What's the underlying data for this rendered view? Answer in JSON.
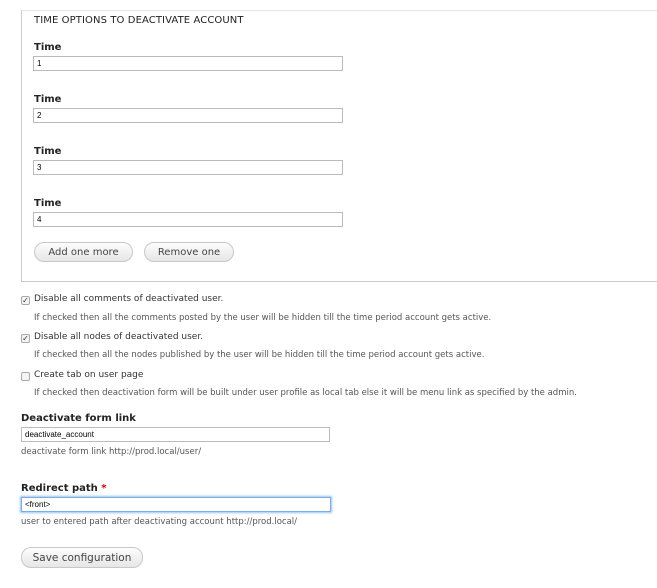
{
  "fieldset": {
    "legend": "TIME OPTIONS TO DEACTIVATE ACCOUNT",
    "times": [
      {
        "label": "Time",
        "value": "1"
      },
      {
        "label": "Time",
        "value": "2"
      },
      {
        "label": "Time",
        "value": "3"
      },
      {
        "label": "Time",
        "value": "4"
      }
    ],
    "add_label": "Add one more",
    "remove_label": "Remove one"
  },
  "options": [
    {
      "label": "Disable all comments of deactivated user.",
      "checked": true,
      "desc": "If checked then all the comments posted by the user will be hidden till the time period account gets active."
    },
    {
      "label": "Disable all nodes of deactivated user.",
      "checked": true,
      "desc": "If checked then all the nodes published by the user will be hidden till the time period account gets active."
    },
    {
      "label": "Create tab on user page",
      "checked": false,
      "desc": "If checked then deactivation form will be built under user profile as local tab else it will be menu link as specified by the admin."
    }
  ],
  "form_link": {
    "label": "Deactivate form link",
    "value": "deactivate_account",
    "desc": "deactivate form link http://prod.local/user/"
  },
  "redirect": {
    "label": "Redirect path",
    "required": "*",
    "value": "<front>",
    "desc": "user to entered path after deactivating account http://prod.local/"
  },
  "save_label": "Save configuration"
}
